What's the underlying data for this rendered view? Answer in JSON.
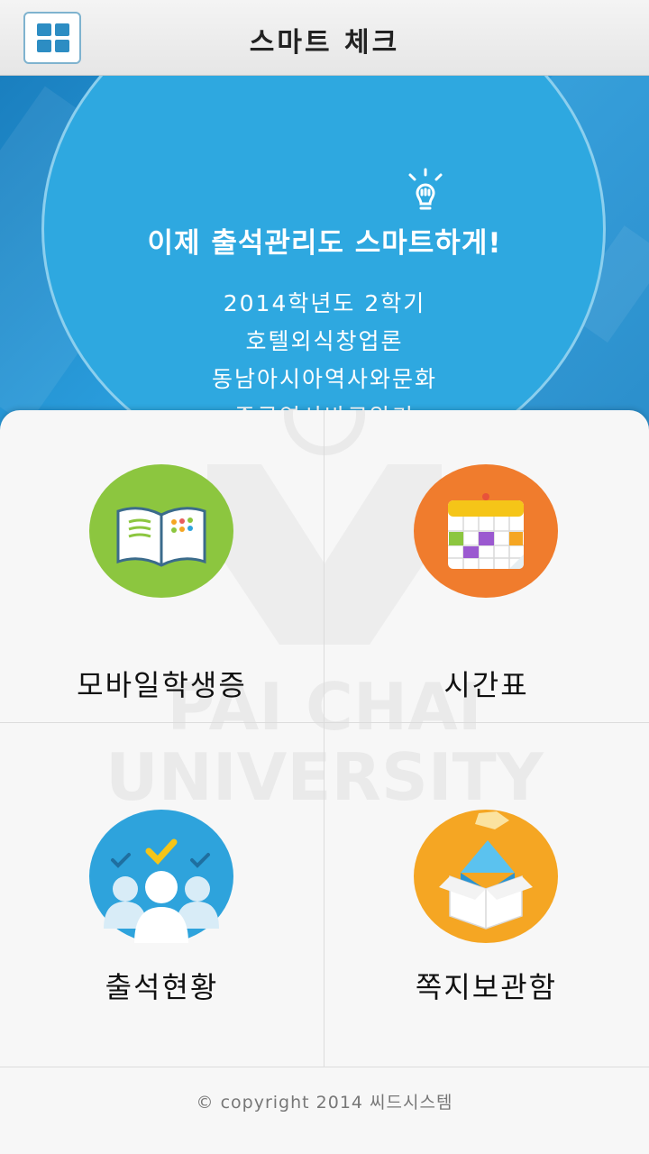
{
  "header": {
    "title": "스마트 체크",
    "menu_icon": "grid-menu-icon"
  },
  "banner": {
    "headline": "이제 출석관리도 스마트하게!",
    "courses": [
      "2014학년도 2학기",
      "호텔외식창업론",
      "동남아시아역사와문화",
      "중국역사바로알기"
    ]
  },
  "watermark": {
    "line1": "PAI CHAI",
    "line2": "UNIVERSITY"
  },
  "menu": [
    {
      "label": "모바일학생증",
      "icon": "open-book-icon",
      "color": "#8cc63f"
    },
    {
      "label": "시간표",
      "icon": "calendar-icon",
      "color": "#f07c2d"
    },
    {
      "label": "출석현황",
      "icon": "attendance-people-icon",
      "color": "#2ea3dc"
    },
    {
      "label": "쪽지보관함",
      "icon": "message-box-icon",
      "color": "#f5a623"
    }
  ],
  "footer": {
    "copyright": "© copyright 2014 씨드시스템"
  }
}
